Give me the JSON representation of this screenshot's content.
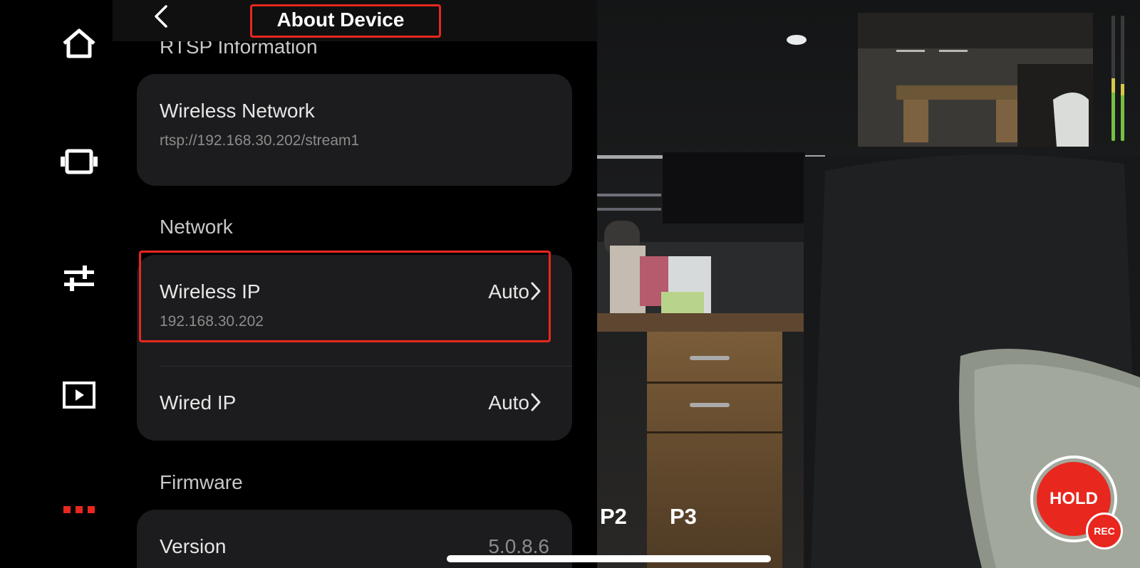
{
  "header": {
    "title": "About Device"
  },
  "rail": {
    "icons": [
      "home-icon",
      "gimbal-icon",
      "sliders-icon",
      "playback-icon",
      "more-dots-icon"
    ],
    "accent": "#e8271e"
  },
  "rtsp": {
    "heading": "RTSP Information",
    "item": {
      "title": "Wireless Network",
      "value": "rtsp://192.168.30.202/stream1"
    }
  },
  "network": {
    "heading": "Network",
    "wireless": {
      "title": "Wireless IP",
      "sub": "192.168.30.202",
      "value": "Auto"
    },
    "wired": {
      "title": "Wired IP",
      "value": "Auto"
    }
  },
  "firmware": {
    "heading": "Firmware",
    "version": {
      "title": "Version",
      "value": "5.0.8.6"
    }
  },
  "camera": {
    "presets": [
      "P2",
      "P3"
    ],
    "hold_label": "HOLD",
    "rec_label": "REC",
    "hold_color": "#e8271e"
  }
}
